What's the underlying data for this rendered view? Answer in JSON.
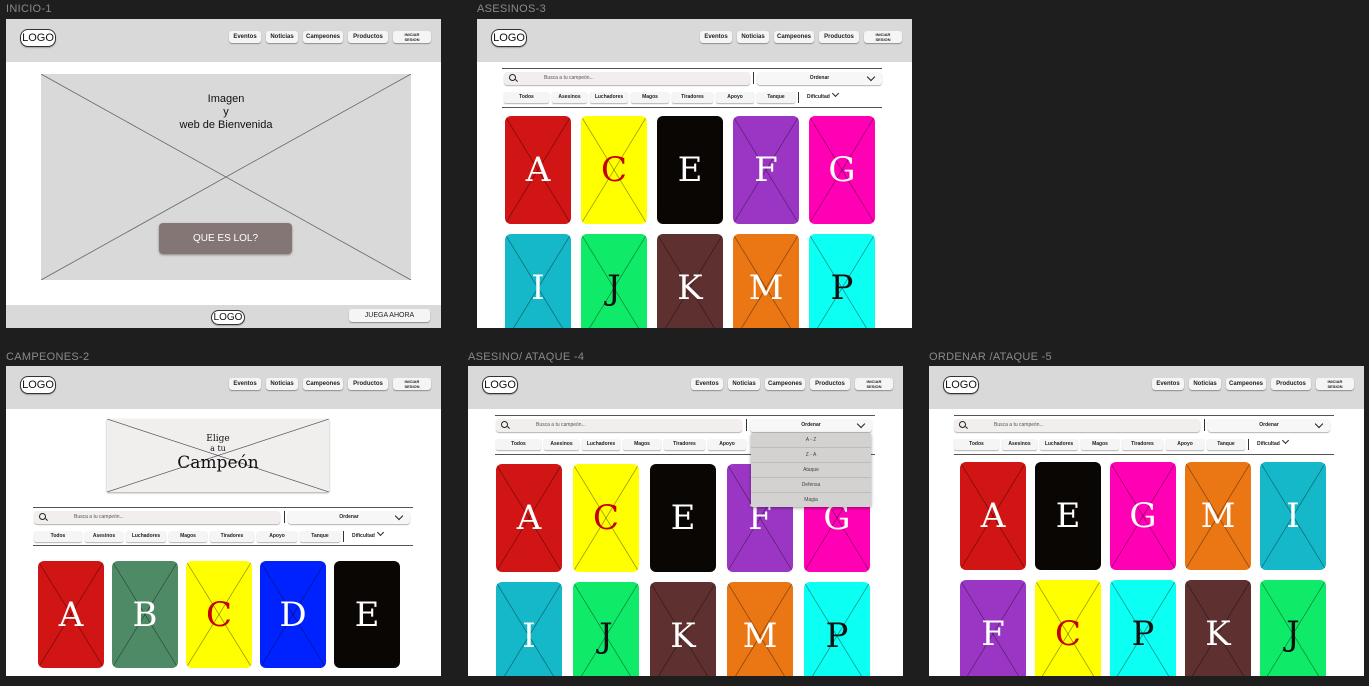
{
  "frames": {
    "inicio": {
      "label": "INICIO-1"
    },
    "asesinos": {
      "label": "ASESINOS-3"
    },
    "campeones": {
      "label": "CAMPEONES-2"
    },
    "asesino_ataque": {
      "label": "ASESINO/ ATAQUE -4"
    },
    "ordenar_ataque": {
      "label": "ORDENAR /ATAQUE -5"
    }
  },
  "header": {
    "logo": "LOGO",
    "nav": [
      "Eventos",
      "Noticias",
      "Campeones",
      "Productos"
    ],
    "login_line1": "INICIAR",
    "login_line2": "SESION"
  },
  "inicio": {
    "hero_line1": "Imagen",
    "hero_line2": "y",
    "hero_line3": "web de Bienvenida",
    "cta": "QUE ES LOL?",
    "footer_logo": "LOGO",
    "footer_button": "JUEGA AHORA"
  },
  "campeones": {
    "banner_line1": "Elige",
    "banner_line2": "a tu",
    "banner_line3": "Campeón"
  },
  "search": {
    "placeholder": "Busca a tu campeón...",
    "order_label": "Ordenar"
  },
  "filters": [
    "Todos",
    "Asesinos",
    "Luchadores",
    "Magos",
    "Tiradores",
    "Apoyo",
    "Tanque"
  ],
  "difficulty_label": "Dificultad",
  "dropdown": [
    "A - Z",
    "Z - A",
    "Ataque",
    "Defensa",
    "Magia"
  ],
  "cards": {
    "asesinos": [
      {
        "letter": "A",
        "color": "#d11414",
        "text": "#ffffff"
      },
      {
        "letter": "C",
        "color": "#ffff00",
        "text": "#c40000"
      },
      {
        "letter": "E",
        "color": "#0a0604",
        "text": "#ffffff"
      },
      {
        "letter": "F",
        "color": "#9b36c4",
        "text": "#ffffff"
      },
      {
        "letter": "G",
        "color": "#ff00b4",
        "text": "#ffffff"
      },
      {
        "letter": "I",
        "color": "#14b8c8",
        "text": "#ffffff"
      },
      {
        "letter": "J",
        "color": "#0fea68",
        "text": "#111111"
      },
      {
        "letter": "K",
        "color": "#5e3030",
        "text": "#ffffff"
      },
      {
        "letter": "M",
        "color": "#ea7614",
        "text": "#ffffff"
      },
      {
        "letter": "P",
        "color": "#0bfff2",
        "text": "#111111"
      }
    ],
    "campeones": [
      {
        "letter": "A",
        "color": "#d11414",
        "text": "#ffffff"
      },
      {
        "letter": "B",
        "color": "#4f8a66",
        "text": "#ffffff"
      },
      {
        "letter": "C",
        "color": "#ffff00",
        "text": "#c40000"
      },
      {
        "letter": "D",
        "color": "#0022ff",
        "text": "#ffffff"
      },
      {
        "letter": "E",
        "color": "#0a0604",
        "text": "#ffffff"
      }
    ],
    "ordenar": [
      {
        "letter": "A",
        "color": "#d11414",
        "text": "#ffffff"
      },
      {
        "letter": "E",
        "color": "#0a0604",
        "text": "#ffffff"
      },
      {
        "letter": "G",
        "color": "#ff00b4",
        "text": "#ffffff"
      },
      {
        "letter": "M",
        "color": "#ea7614",
        "text": "#ffffff"
      },
      {
        "letter": "I",
        "color": "#14b8c8",
        "text": "#ffffff"
      },
      {
        "letter": "F",
        "color": "#9b36c4",
        "text": "#ffffff"
      },
      {
        "letter": "C",
        "color": "#ffff00",
        "text": "#c40000"
      },
      {
        "letter": "P",
        "color": "#0bfff2",
        "text": "#111111"
      },
      {
        "letter": "K",
        "color": "#5e3030",
        "text": "#ffffff"
      },
      {
        "letter": "J",
        "color": "#0fea68",
        "text": "#111111"
      }
    ]
  }
}
